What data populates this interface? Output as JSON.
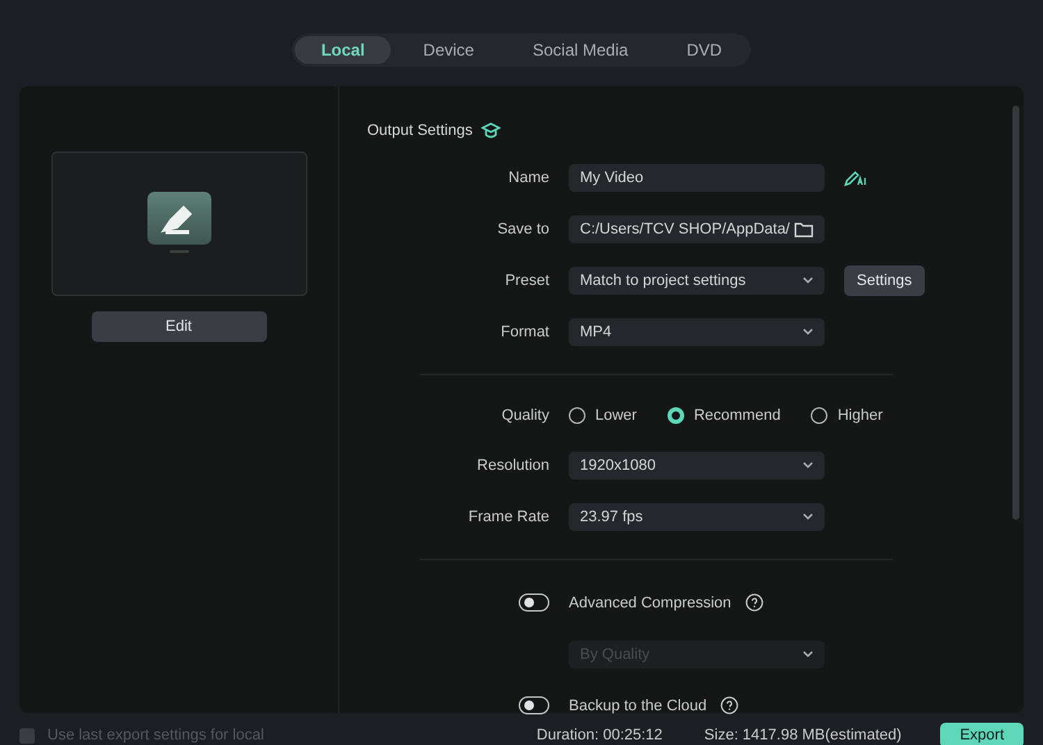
{
  "tabs": [
    {
      "label": "Local",
      "selected": true
    },
    {
      "label": "Device",
      "selected": false
    },
    {
      "label": "Social Media",
      "selected": false
    },
    {
      "label": "DVD",
      "selected": false
    }
  ],
  "preview": {
    "edit_button": "Edit"
  },
  "output_settings": {
    "title": "Output Settings",
    "rows": [
      {
        "kind": "text",
        "label": "Name",
        "value": "My Video",
        "ai_button": true
      },
      {
        "kind": "path",
        "label": "Save to",
        "value": "C:/Users/TCV SHOP/AppData/"
      },
      {
        "kind": "select",
        "label": "Preset",
        "value": "Match to project settings",
        "button": "Settings"
      },
      {
        "kind": "select",
        "label": "Format",
        "value": "MP4"
      },
      {
        "kind": "divider"
      },
      {
        "kind": "radio",
        "label": "Quality",
        "options": [
          {
            "label": "Lower",
            "selected": false
          },
          {
            "label": "Recommend",
            "selected": true
          },
          {
            "label": "Higher",
            "selected": false
          }
        ]
      },
      {
        "kind": "select",
        "label": "Resolution",
        "value": "1920x1080"
      },
      {
        "kind": "select",
        "label": "Frame Rate",
        "value": "23.97 fps"
      },
      {
        "kind": "divider"
      },
      {
        "kind": "toggle",
        "label": "Advanced Compression",
        "on": false
      },
      {
        "kind": "select",
        "value": "By Quality",
        "disabled": true
      },
      {
        "kind": "toggle",
        "label": "Backup to the Cloud",
        "on": false
      }
    ]
  },
  "footer": {
    "checkbox": {
      "label": "Use last export settings for local",
      "checked": false
    },
    "duration": "Duration: 00:25:12",
    "size": "Size: 1417.98 MB(estimated)",
    "export_button": "Export"
  }
}
